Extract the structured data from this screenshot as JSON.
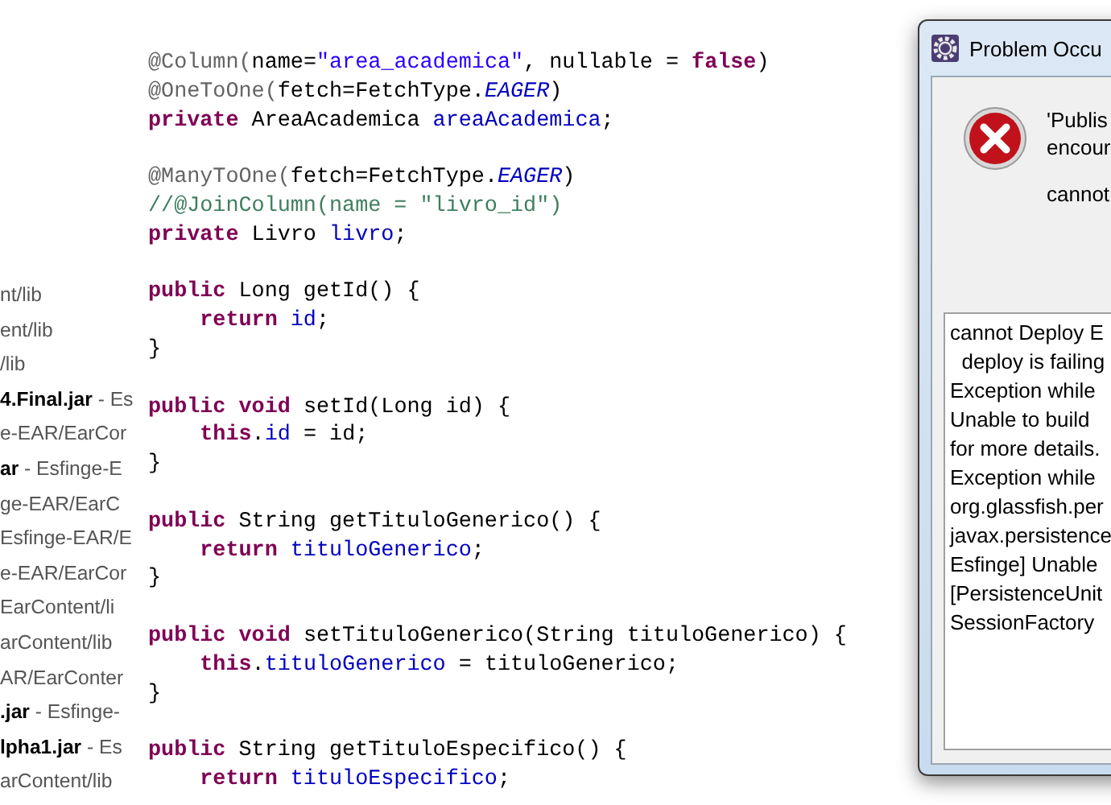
{
  "file_list": [
    {
      "text": "nt/lib"
    },
    {
      "text": "ent/lib"
    },
    {
      "text": "/lib"
    },
    {
      "text": "**4.Final.jar** - Es"
    },
    {
      "text": "e-EAR/EarCor"
    },
    {
      "text": "**ar** - Esfinge-E"
    },
    {
      "text": "ge-EAR/EarC"
    },
    {
      "text": "Esfinge-EAR/E"
    },
    {
      "text": "e-EAR/EarCor"
    },
    {
      "text": "EarContent/li"
    },
    {
      "text": "arContent/lib"
    },
    {
      "text": "AR/EarConter"
    },
    {
      "text": "**.jar** - Esfinge-"
    },
    {
      "text": "**lpha1.jar** - Es"
    },
    {
      "text": "arContent/lib"
    }
  ],
  "code_blocks": [
    [
      [
        {
          "text": "@Column(",
          "kind": "annotation"
        },
        {
          "text": "name=",
          "kind": "plain"
        },
        {
          "text": "\"area_academica\"",
          "kind": "string"
        },
        {
          "text": ", nullable = ",
          "kind": "plain"
        },
        {
          "text": "false",
          "kind": "keyword"
        },
        {
          "text": ")",
          "kind": "plain"
        }
      ],
      [
        {
          "text": "@OneToOne(",
          "kind": "annotation"
        },
        {
          "text": "fetch=FetchType.",
          "kind": "plain"
        },
        {
          "text": "EAGER",
          "kind": "static"
        },
        {
          "text": ")",
          "kind": "plain"
        }
      ],
      [
        {
          "text": "private",
          "kind": "keyword"
        },
        {
          "text": " AreaAcademica ",
          "kind": "plain"
        },
        {
          "text": "areaAcademica",
          "kind": "field"
        },
        {
          "text": ";",
          "kind": "plain"
        }
      ]
    ],
    [
      [
        {
          "text": "@ManyToOne(",
          "kind": "annotation"
        },
        {
          "text": "fetch=FetchType.",
          "kind": "plain"
        },
        {
          "text": "EAGER",
          "kind": "static"
        },
        {
          "text": ")",
          "kind": "plain"
        }
      ],
      [
        {
          "text": "//@JoinColumn(name = \"livro_id\")",
          "kind": "comment"
        }
      ],
      [
        {
          "text": "private",
          "kind": "keyword"
        },
        {
          "text": " Livro ",
          "kind": "plain"
        },
        {
          "text": "livro",
          "kind": "field"
        },
        {
          "text": ";",
          "kind": "plain"
        }
      ]
    ],
    [
      [
        {
          "text": "public",
          "kind": "keyword"
        },
        {
          "text": " Long getId() {",
          "kind": "plain"
        }
      ],
      [
        {
          "text": "    return",
          "kind": "keyword"
        },
        {
          "text": " id",
          "kind": "field"
        },
        {
          "text": ";",
          "kind": "plain"
        }
      ],
      [
        {
          "text": "}",
          "kind": "plain"
        }
      ]
    ],
    [
      [
        {
          "text": "public void",
          "kind": "keyword"
        },
        {
          "text": " setId(Long id) {",
          "kind": "plain"
        }
      ],
      [
        {
          "text": "    this",
          "kind": "keyword"
        },
        {
          "text": ".",
          "kind": "plain"
        },
        {
          "text": "id",
          "kind": "field"
        },
        {
          "text": " = id;",
          "kind": "plain"
        }
      ],
      [
        {
          "text": "}",
          "kind": "plain"
        }
      ]
    ],
    [
      [
        {
          "text": "public",
          "kind": "keyword"
        },
        {
          "text": " String getTituloGenerico() {",
          "kind": "plain"
        }
      ],
      [
        {
          "text": "    return",
          "kind": "keyword"
        },
        {
          "text": " tituloGenerico",
          "kind": "field"
        },
        {
          "text": ";",
          "kind": "plain"
        }
      ],
      [
        {
          "text": "}",
          "kind": "plain"
        }
      ]
    ],
    [
      [
        {
          "text": "public void",
          "kind": "keyword"
        },
        {
          "text": " setTituloGenerico(String tituloGenerico) {",
          "kind": "plain"
        }
      ],
      [
        {
          "text": "    this",
          "kind": "keyword"
        },
        {
          "text": ".",
          "kind": "plain"
        },
        {
          "text": "tituloGenerico",
          "kind": "field"
        },
        {
          "text": " = tituloGenerico;",
          "kind": "plain"
        }
      ],
      [
        {
          "text": "}",
          "kind": "plain"
        }
      ]
    ],
    [
      [
        {
          "text": "public",
          "kind": "keyword"
        },
        {
          "text": " String getTituloEspecifico() {",
          "kind": "plain"
        }
      ],
      [
        {
          "text": "    return",
          "kind": "keyword"
        },
        {
          "text": " tituloEspecifico",
          "kind": "field"
        },
        {
          "text": ";",
          "kind": "plain"
        }
      ]
    ]
  ],
  "dialog": {
    "title": "Problem Occu",
    "message_lines": [
      "'Publis",
      "encour"
    ],
    "reason": "cannot",
    "details": [
      "cannot Deploy E",
      "  deploy is failing",
      "Exception while",
      "Unable to build",
      "for more details.",
      "Exception while",
      "org.glassfish.per",
      "javax.persistence",
      "Esfinge] Unable",
      "[PersistenceUnit",
      "SessionFactory"
    ]
  }
}
